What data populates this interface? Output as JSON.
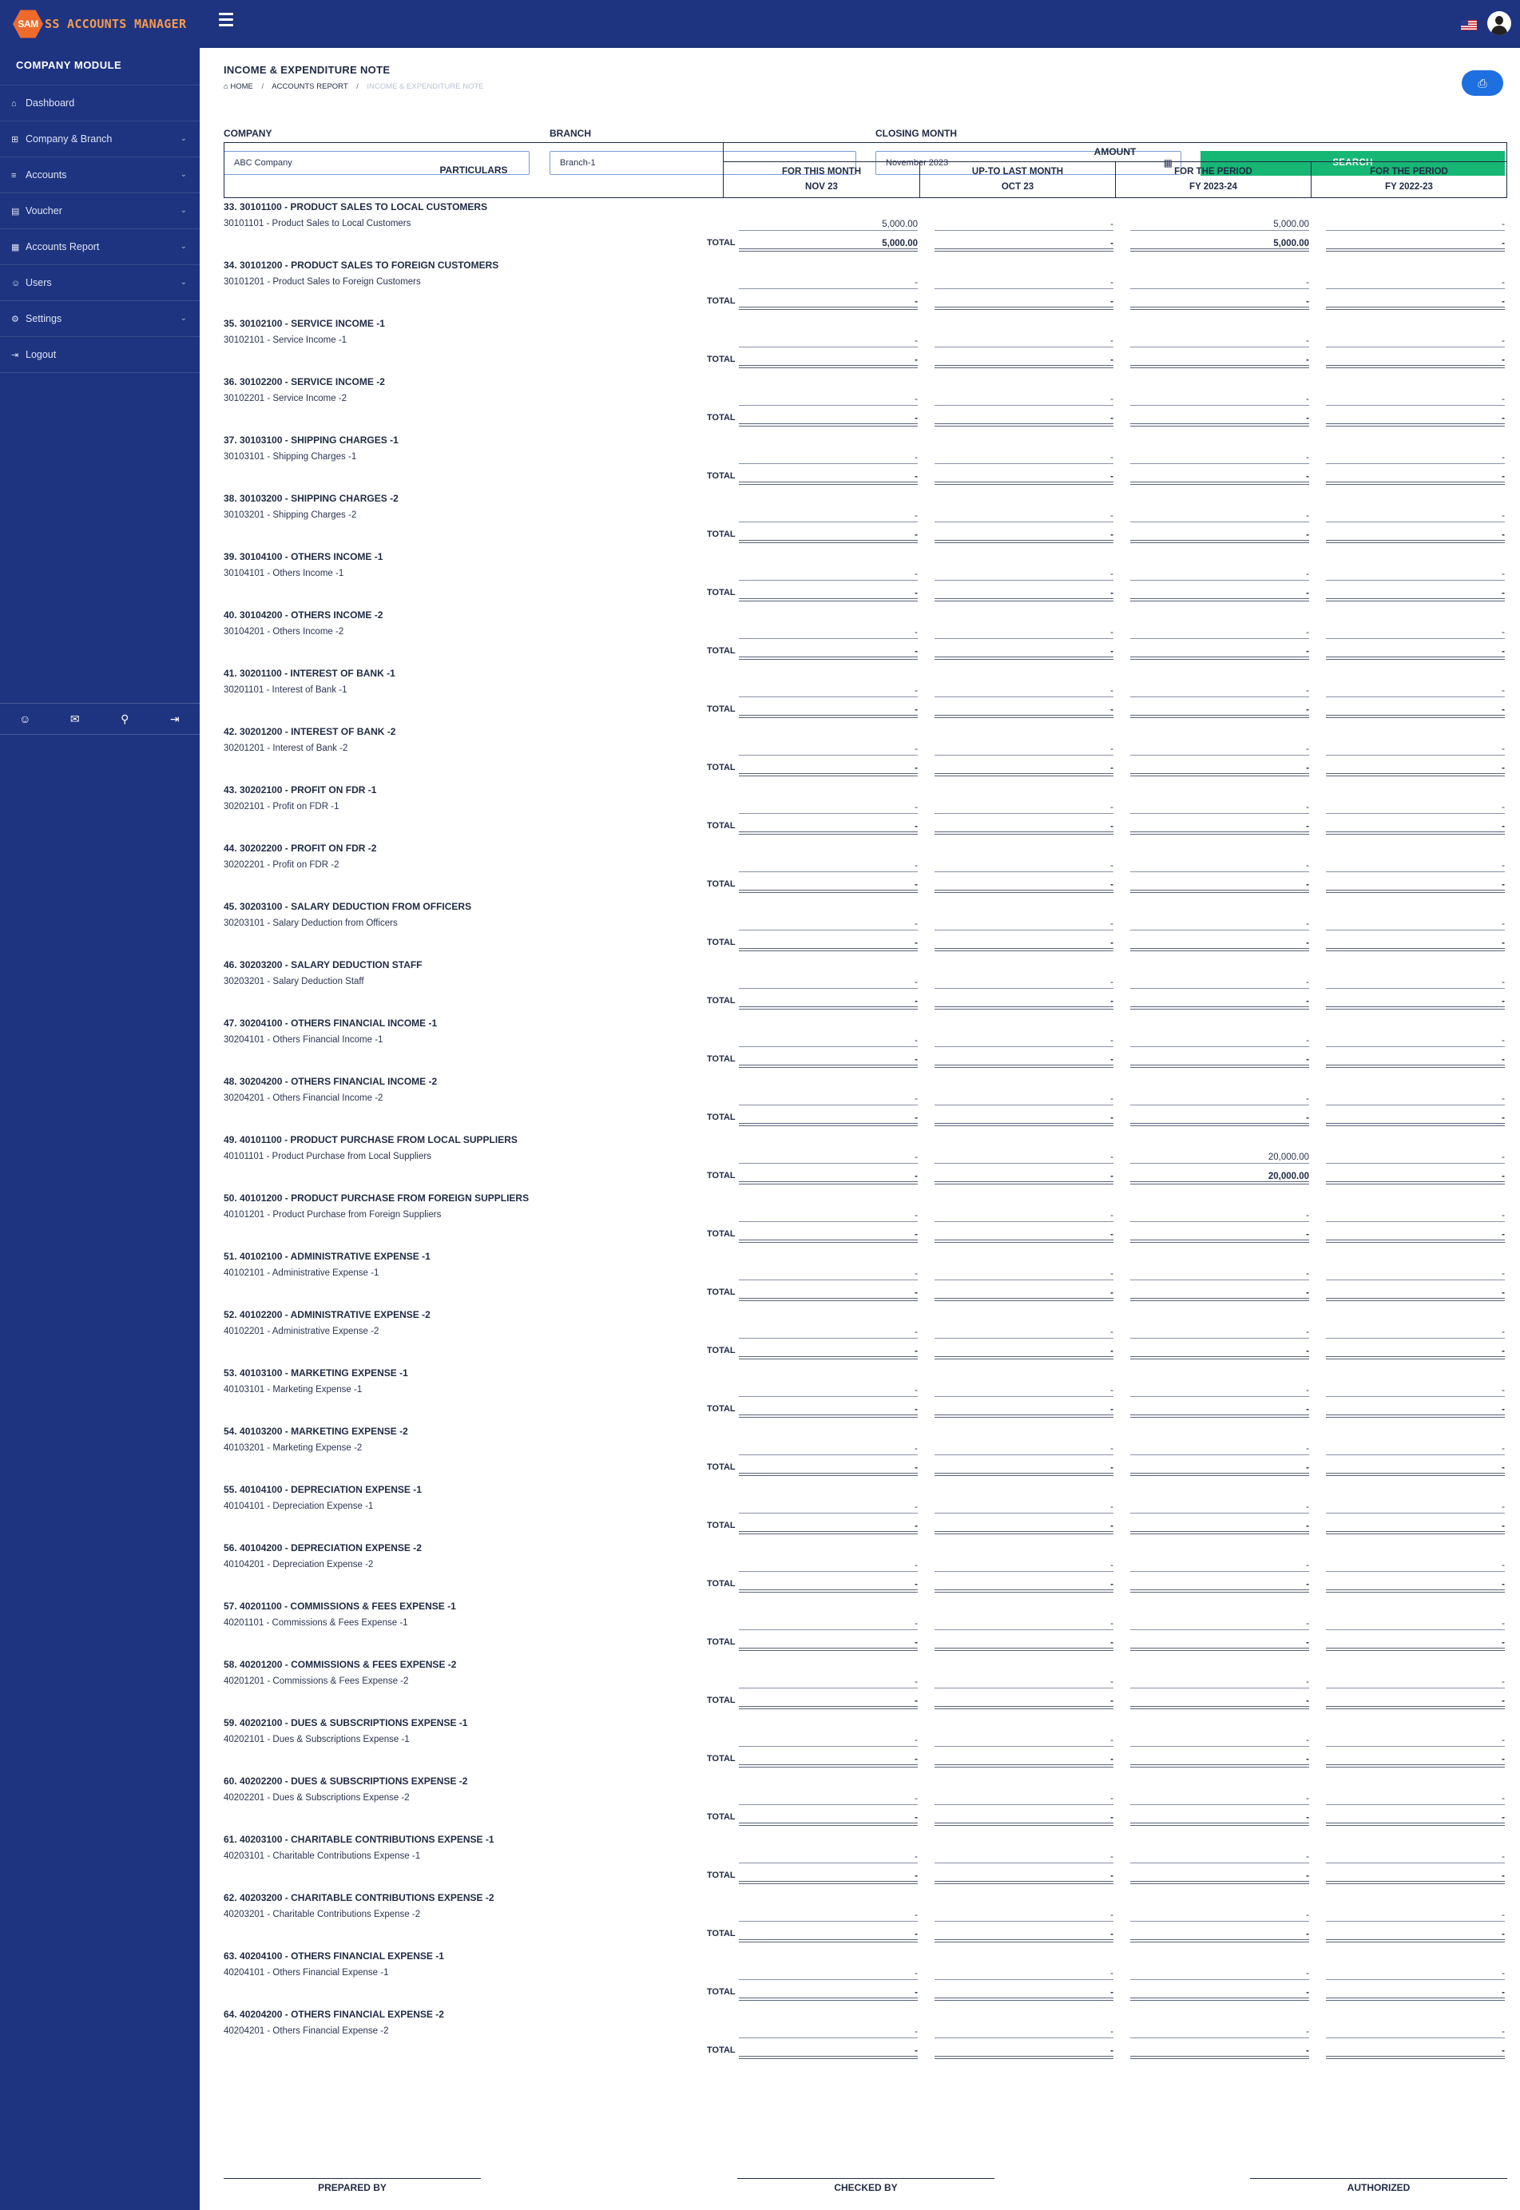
{
  "app": {
    "logo_badge": "SAM",
    "logo_text": "SS ACCOUNTS MANAGER"
  },
  "icons": {
    "menu": "hamburger-icon",
    "flag": "us-flag-icon",
    "user": "user-avatar-icon",
    "print": "printer-icon",
    "calendar": "calendar-icon"
  },
  "sidebar": {
    "module_title": "COMPANY MODULE",
    "items": [
      {
        "label": "Dashboard",
        "icon": "⌂",
        "expandable": false
      },
      {
        "label": "Company & Branch",
        "icon": "⊞",
        "expandable": true
      },
      {
        "label": "Accounts",
        "icon": "≡",
        "expandable": true
      },
      {
        "label": "Voucher",
        "icon": "▤",
        "expandable": true
      },
      {
        "label": "Accounts Report",
        "icon": "▦",
        "expandable": true
      },
      {
        "label": "Users",
        "icon": "☺",
        "expandable": true
      },
      {
        "label": "Settings",
        "icon": "⚙",
        "expandable": true
      },
      {
        "label": "Logout",
        "icon": "⇥",
        "expandable": false
      }
    ],
    "footer_icons": [
      "profile-icon",
      "mail-icon",
      "lock-icon",
      "sign-out-icon"
    ]
  },
  "page": {
    "title": "INCOME & EXPENDITURE NOTE",
    "breadcrumb": [
      "HOME",
      "ACCOUNTS REPORT",
      "INCOME & EXPENDITURE NOTE"
    ]
  },
  "filters": {
    "company": {
      "label": "COMPANY",
      "value": "ABC Company"
    },
    "branch": {
      "label": "BRANCH",
      "value": "Branch-1"
    },
    "closing_month": {
      "label": "CLOSING MONTH",
      "value": "November 2023"
    },
    "search_label": "SEARCH"
  },
  "table": {
    "particulars_header": "PARTICULARS",
    "amount_header": "AMOUNT",
    "columns": [
      {
        "line1": "FOR THIS MONTH",
        "line2": "NOV 23"
      },
      {
        "line1": "UP-TO LAST MONTH",
        "line2": "OCT 23"
      },
      {
        "line1": "FOR THE PERIOD",
        "line2": "FY 2023-24"
      },
      {
        "line1": "FOR THE PERIOD",
        "line2": "FY 2022-23"
      }
    ],
    "total_label": "TOTAL",
    "groups": [
      {
        "title": "33. 30101100 - PRODUCT SALES TO LOCAL CUSTOMERS",
        "sub": "30101101 - Product Sales to Local Customers",
        "values": [
          "5,000.00",
          "-",
          "5,000.00",
          "-"
        ],
        "totals": [
          "5,000.00",
          "-",
          "5,000.00",
          "-"
        ]
      },
      {
        "title": "34. 30101200 - PRODUCT SALES TO FOREIGN CUSTOMERS",
        "sub": "30101201 - Product Sales to Foreign Customers",
        "values": [
          "-",
          "-",
          "-",
          "-"
        ],
        "totals": [
          "-",
          "-",
          "-",
          "-"
        ]
      },
      {
        "title": "35. 30102100 - SERVICE INCOME -1",
        "sub": "30102101 - Service Income -1",
        "values": [
          "-",
          "-",
          "-",
          "-"
        ],
        "totals": [
          "-",
          "-",
          "-",
          "-"
        ]
      },
      {
        "title": "36. 30102200 - SERVICE INCOME -2",
        "sub": "30102201 - Service Income -2",
        "values": [
          "-",
          "-",
          "-",
          "-"
        ],
        "totals": [
          "-",
          "-",
          "-",
          "-"
        ]
      },
      {
        "title": "37. 30103100 - SHIPPING CHARGES -1",
        "sub": "30103101 - Shipping Charges -1",
        "values": [
          "-",
          "-",
          "-",
          "-"
        ],
        "totals": [
          "-",
          "-",
          "-",
          "-"
        ]
      },
      {
        "title": "38. 30103200 - SHIPPING CHARGES -2",
        "sub": "30103201 - Shipping Charges -2",
        "values": [
          "-",
          "-",
          "-",
          "-"
        ],
        "totals": [
          "-",
          "-",
          "-",
          "-"
        ]
      },
      {
        "title": "39. 30104100 - OTHERS INCOME -1",
        "sub": "30104101 - Others Income -1",
        "values": [
          "-",
          "-",
          "-",
          "-"
        ],
        "totals": [
          "-",
          "-",
          "-",
          "-"
        ]
      },
      {
        "title": "40. 30104200 - OTHERS INCOME -2",
        "sub": "30104201 - Others Income -2",
        "values": [
          "-",
          "-",
          "-",
          "-"
        ],
        "totals": [
          "-",
          "-",
          "-",
          "-"
        ]
      },
      {
        "title": "41. 30201100 - INTEREST OF BANK -1",
        "sub": "30201101 - Interest of Bank -1",
        "values": [
          "-",
          "-",
          "-",
          "-"
        ],
        "totals": [
          "-",
          "-",
          "-",
          "-"
        ]
      },
      {
        "title": "42. 30201200 - INTEREST OF BANK -2",
        "sub": "30201201 - Interest of Bank -2",
        "values": [
          "-",
          "-",
          "-",
          "-"
        ],
        "totals": [
          "-",
          "-",
          "-",
          "-"
        ]
      },
      {
        "title": "43. 30202100 - PROFIT ON FDR -1",
        "sub": "30202101 - Profit on FDR -1",
        "values": [
          "-",
          "-",
          "-",
          "-"
        ],
        "totals": [
          "-",
          "-",
          "-",
          "-"
        ]
      },
      {
        "title": "44. 30202200 - PROFIT ON FDR -2",
        "sub": "30202201 - Profit on FDR -2",
        "values": [
          "-",
          "-",
          "-",
          "-"
        ],
        "totals": [
          "-",
          "-",
          "-",
          "-"
        ]
      },
      {
        "title": "45. 30203100 - SALARY DEDUCTION FROM OFFICERS",
        "sub": "30203101 - Salary Deduction from Officers",
        "values": [
          "-",
          "-",
          "-",
          "-"
        ],
        "totals": [
          "-",
          "-",
          "-",
          "-"
        ]
      },
      {
        "title": "46. 30203200 - SALARY DEDUCTION STAFF",
        "sub": "30203201 - Salary Deduction Staff",
        "values": [
          "-",
          "-",
          "-",
          "-"
        ],
        "totals": [
          "-",
          "-",
          "-",
          "-"
        ]
      },
      {
        "title": "47. 30204100 - OTHERS FINANCIAL INCOME -1",
        "sub": "30204101 - Others Financial Income -1",
        "values": [
          "-",
          "-",
          "-",
          "-"
        ],
        "totals": [
          "-",
          "-",
          "-",
          "-"
        ]
      },
      {
        "title": "48. 30204200 - OTHERS FINANCIAL INCOME -2",
        "sub": "30204201 - Others Financial Income -2",
        "values": [
          "-",
          "-",
          "-",
          "-"
        ],
        "totals": [
          "-",
          "-",
          "-",
          "-"
        ]
      },
      {
        "title": "49. 40101100 - PRODUCT PURCHASE FROM LOCAL SUPPLIERS",
        "sub": "40101101 - Product Purchase from Local Suppliers",
        "values": [
          "-",
          "-",
          "20,000.00",
          "-"
        ],
        "totals": [
          "-",
          "-",
          "20,000.00",
          "-"
        ]
      },
      {
        "title": "50. 40101200 - PRODUCT PURCHASE FROM FOREIGN SUPPLIERS",
        "sub": "40101201 - Product Purchase from Foreign Suppliers",
        "values": [
          "-",
          "-",
          "-",
          "-"
        ],
        "totals": [
          "-",
          "-",
          "-",
          "-"
        ]
      },
      {
        "title": "51. 40102100 - ADMINISTRATIVE EXPENSE -1",
        "sub": "40102101 - Administrative Expense -1",
        "values": [
          "-",
          "-",
          "-",
          "-"
        ],
        "totals": [
          "-",
          "-",
          "-",
          "-"
        ]
      },
      {
        "title": "52. 40102200 - ADMINISTRATIVE EXPENSE -2",
        "sub": "40102201 - Administrative Expense -2",
        "values": [
          "-",
          "-",
          "-",
          "-"
        ],
        "totals": [
          "-",
          "-",
          "-",
          "-"
        ]
      },
      {
        "title": "53. 40103100 - MARKETING EXPENSE -1",
        "sub": "40103101 - Marketing Expense -1",
        "values": [
          "-",
          "-",
          "-",
          "-"
        ],
        "totals": [
          "-",
          "-",
          "-",
          "-"
        ]
      },
      {
        "title": "54. 40103200 - MARKETING EXPENSE -2",
        "sub": "40103201 - Marketing Expense -2",
        "values": [
          "-",
          "-",
          "-",
          "-"
        ],
        "totals": [
          "-",
          "-",
          "-",
          "-"
        ]
      },
      {
        "title": "55. 40104100 - DEPRECIATION EXPENSE -1",
        "sub": "40104101 - Depreciation Expense -1",
        "values": [
          "-",
          "-",
          "-",
          "-"
        ],
        "totals": [
          "-",
          "-",
          "-",
          "-"
        ]
      },
      {
        "title": "56. 40104200 - DEPRECIATION EXPENSE -2",
        "sub": "40104201 - Depreciation Expense -2",
        "values": [
          "-",
          "-",
          "-",
          "-"
        ],
        "totals": [
          "-",
          "-",
          "-",
          "-"
        ]
      },
      {
        "title": "57. 40201100 - COMMISSIONS & FEES EXPENSE -1",
        "sub": "40201101 - Commissions & Fees Expense -1",
        "values": [
          "-",
          "-",
          "-",
          "-"
        ],
        "totals": [
          "-",
          "-",
          "-",
          "-"
        ]
      },
      {
        "title": "58. 40201200 - COMMISSIONS & FEES EXPENSE -2",
        "sub": "40201201 - Commissions & Fees Expense -2",
        "values": [
          "-",
          "-",
          "-",
          "-"
        ],
        "totals": [
          "-",
          "-",
          "-",
          "-"
        ]
      },
      {
        "title": "59. 40202100 - DUES & SUBSCRIPTIONS EXPENSE -1",
        "sub": "40202101 - Dues & Subscriptions Expense -1",
        "values": [
          "-",
          "-",
          "-",
          "-"
        ],
        "totals": [
          "-",
          "-",
          "-",
          "-"
        ]
      },
      {
        "title": "60. 40202200 - DUES & SUBSCRIPTIONS EXPENSE -2",
        "sub": "40202201 - Dues & Subscriptions Expense -2",
        "values": [
          "-",
          "-",
          "-",
          "-"
        ],
        "totals": [
          "-",
          "-",
          "-",
          "-"
        ]
      },
      {
        "title": "61. 40203100 - CHARITABLE CONTRIBUTIONS EXPENSE -1",
        "sub": "40203101 - Charitable Contributions Expense -1",
        "values": [
          "-",
          "-",
          "-",
          "-"
        ],
        "totals": [
          "-",
          "-",
          "-",
          "-"
        ]
      },
      {
        "title": "62. 40203200 - CHARITABLE CONTRIBUTIONS EXPENSE -2",
        "sub": "40203201 - Charitable Contributions Expense -2",
        "values": [
          "-",
          "-",
          "-",
          "-"
        ],
        "totals": [
          "-",
          "-",
          "-",
          "-"
        ]
      },
      {
        "title": "63. 40204100 - OTHERS FINANCIAL EXPENSE -1",
        "sub": "40204101 - Others Financial Expense -1",
        "values": [
          "-",
          "-",
          "-",
          "-"
        ],
        "totals": [
          "-",
          "-",
          "-",
          "-"
        ]
      },
      {
        "title": "64. 40204200 - OTHERS FINANCIAL EXPENSE -2",
        "sub": "40204201 - Others Financial Expense -2",
        "values": [
          "-",
          "-",
          "-",
          "-"
        ],
        "totals": [
          "-",
          "-",
          "-",
          "-"
        ]
      }
    ]
  },
  "signatures": [
    "PREPARED BY",
    "CHECKED BY",
    "AUTHORIZED"
  ]
}
